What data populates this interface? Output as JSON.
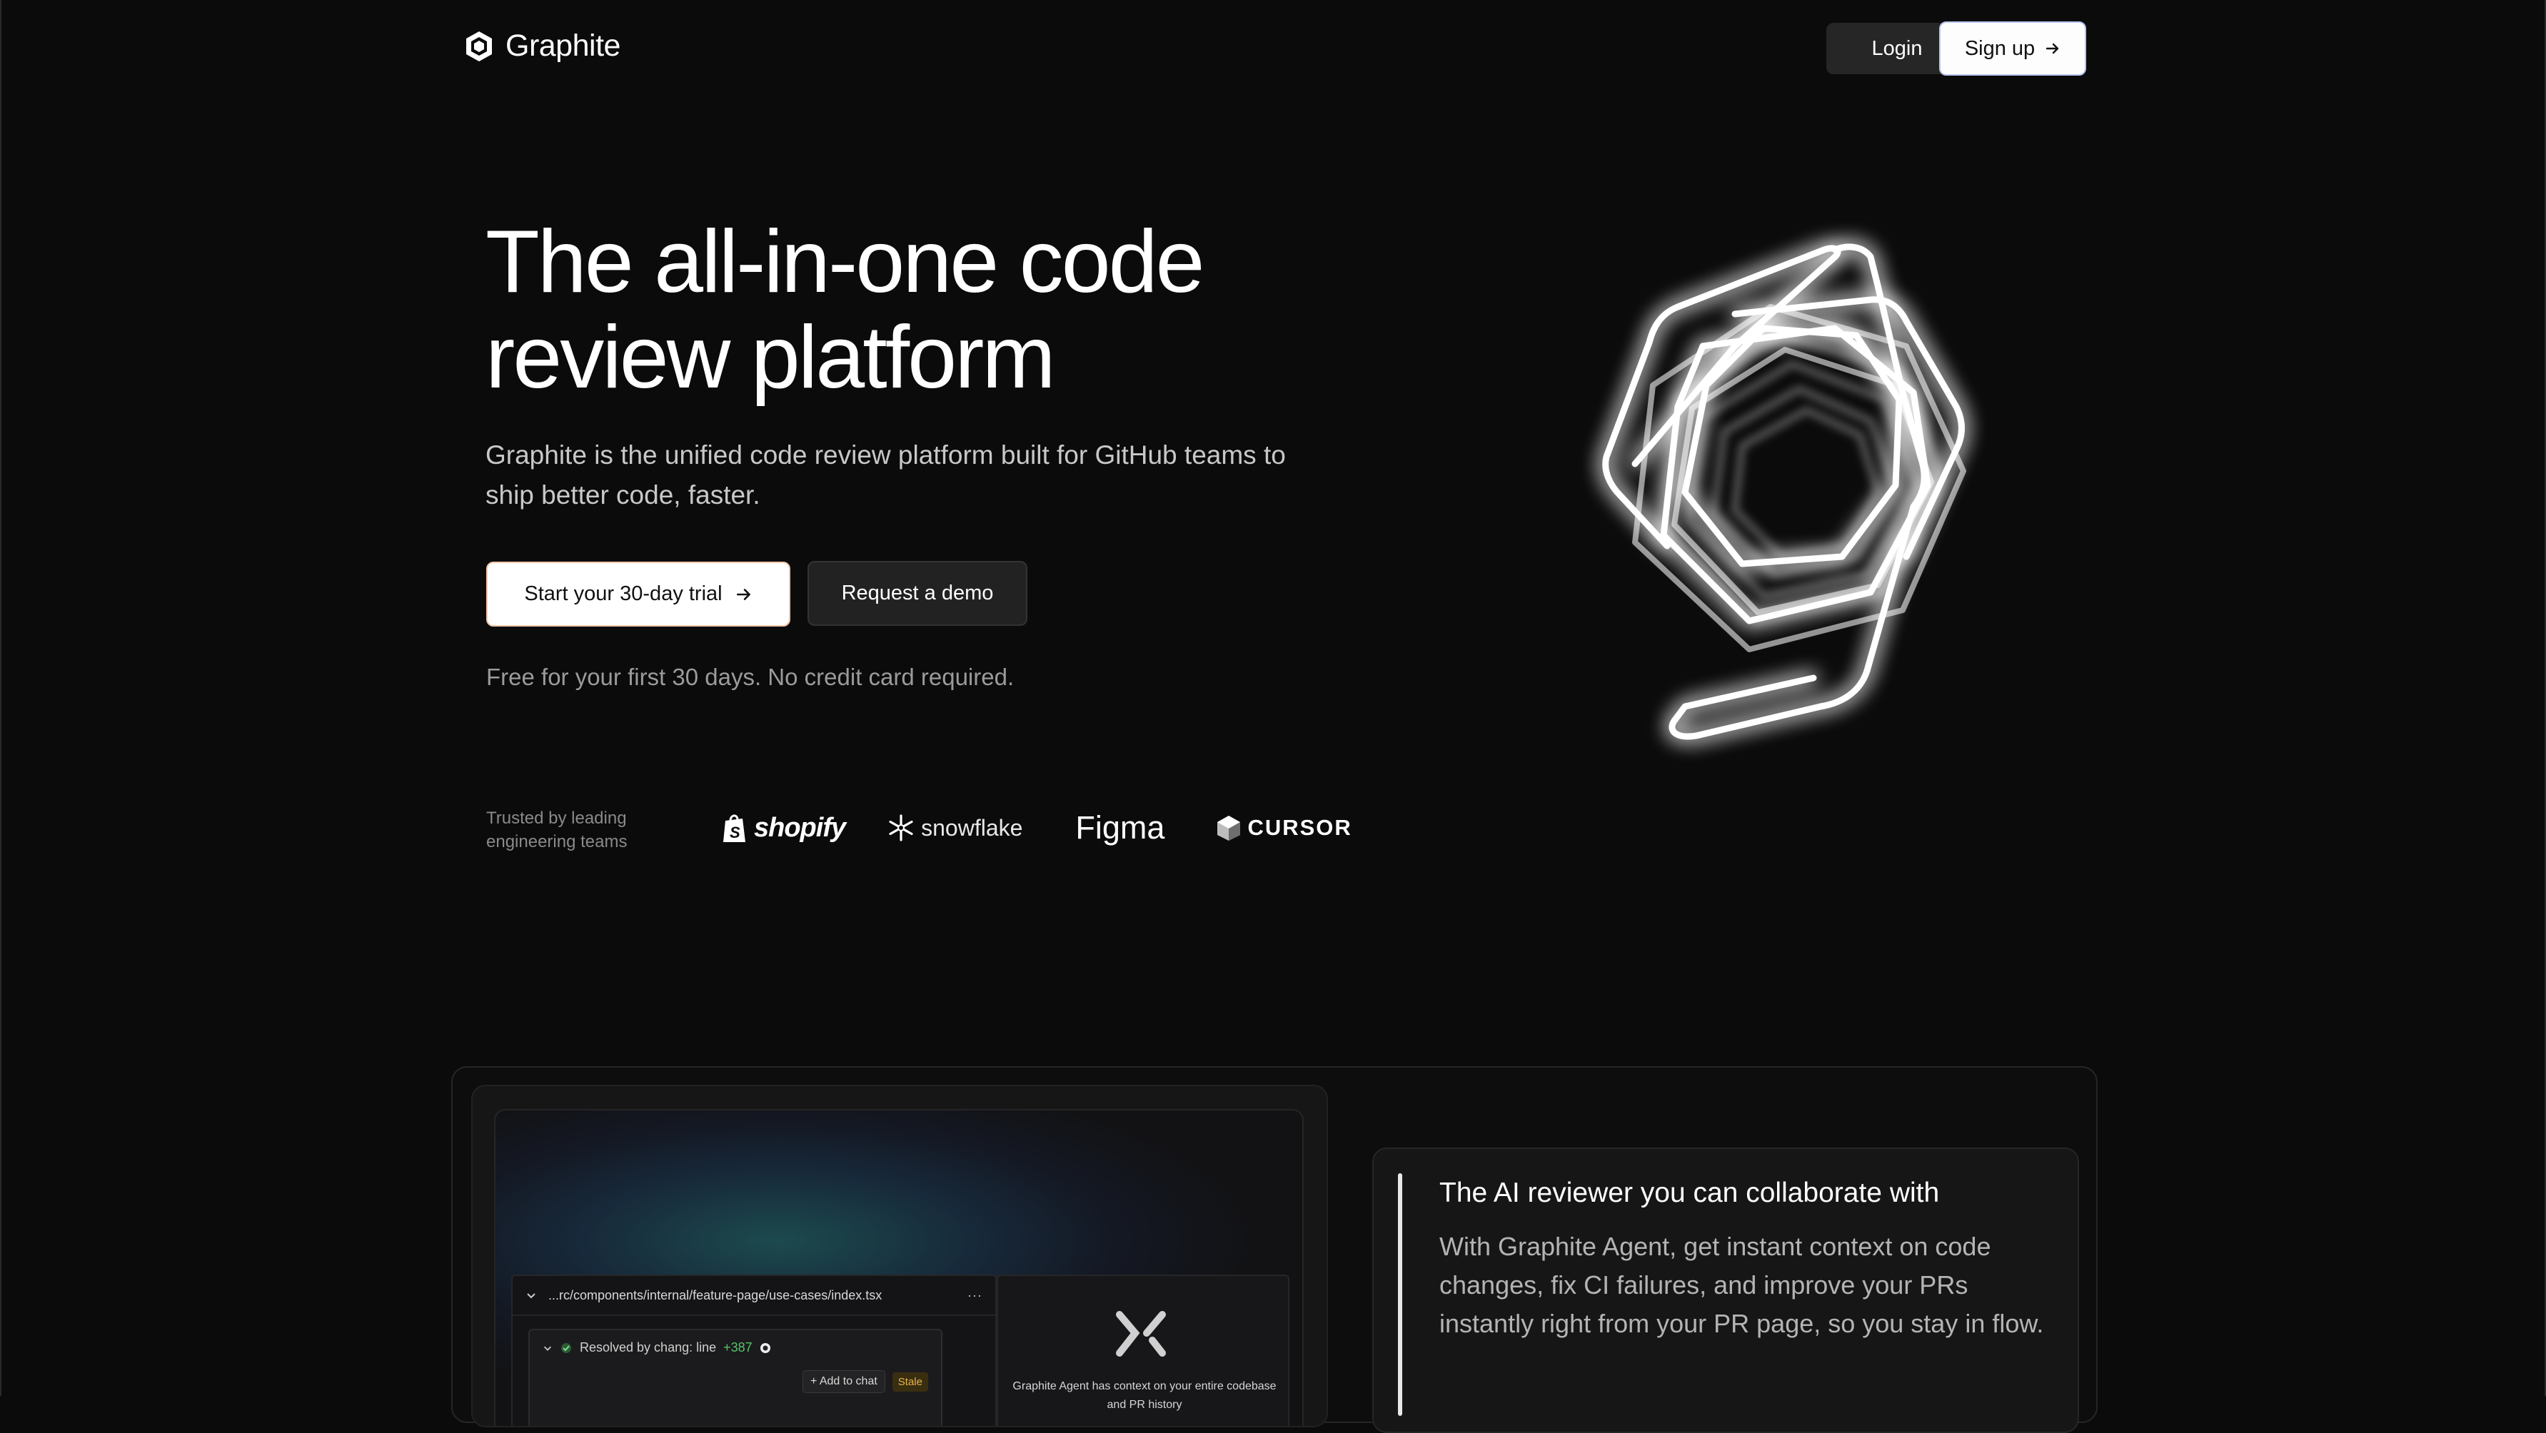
{
  "nav": {
    "brand": "Graphite",
    "login_label": "Login",
    "signup_label": "Sign up"
  },
  "hero": {
    "title_line1": "The all-in-one code",
    "title_line2": "review platform",
    "subtitle": "Graphite is the unified code review platform built for GitHub teams to ship better code, faster.",
    "primary_cta": "Start your 30-day trial",
    "secondary_cta": "Request a demo",
    "note": "Free for your first 30 days. No credit card required."
  },
  "trusted": {
    "label": "Trusted by leading engineering teams",
    "logos": [
      "shopify",
      "snowflake",
      "Figma",
      "CURSOR"
    ]
  },
  "preview": {
    "file_path": "...rc/components/internal/feature-page/use-cases/index.tsx",
    "more": "···",
    "thread_resolved": "Resolved by chang: line",
    "thread_lines": "+387",
    "add_to_chat": "Add to chat",
    "stale_badge": "Stale",
    "agent_text": "Graphite Agent has context on your entire codebase and PR history"
  },
  "feature": {
    "title": "The AI reviewer you can collaborate with",
    "text": "With Graphite Agent, get instant context on code changes, fix CI failures, and improve your PRs instantly right from your PR page, so you stay in flow."
  },
  "icons": {
    "brand": "graphite-logo-icon",
    "arrow": "arrow-right-icon",
    "chevron": "chevron-down-icon",
    "agent": "graphite-agent-icon"
  },
  "colors": {
    "background": "#0b0b0c",
    "signup_border": "#b9c6f2",
    "trial_border": "#f3c7a9",
    "diff_added": "#57c16a",
    "stale": "#e6b34a"
  }
}
